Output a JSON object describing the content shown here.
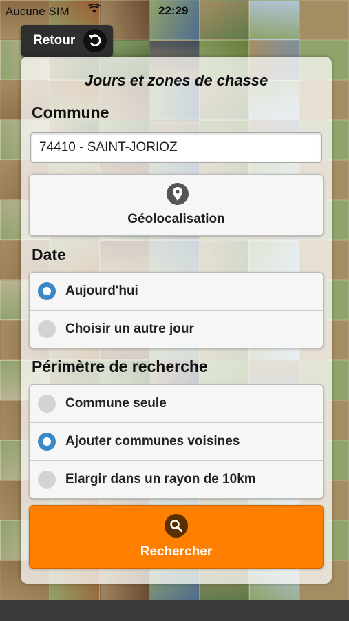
{
  "status": {
    "carrier": "Aucune SIM",
    "time": "22:29",
    "wifi_icon": "wifi-icon"
  },
  "nav": {
    "back_label": "Retour",
    "back_icon": "undo-arrow-icon"
  },
  "form": {
    "title": "Jours et zones de chasse",
    "commune": {
      "label": "Commune",
      "value": "74410 - SAINT-JORIOZ"
    },
    "geolocation": {
      "label": "Géolocalisation",
      "icon": "map-pin-icon"
    },
    "date": {
      "label": "Date",
      "options": [
        {
          "label": "Aujourd'hui",
          "selected": true
        },
        {
          "label": "Choisir un autre jour",
          "selected": false
        }
      ]
    },
    "perimeter": {
      "label": "Périmètre de recherche",
      "options": [
        {
          "label": "Commune seule",
          "selected": false
        },
        {
          "label": "Ajouter communes voisines",
          "selected": true
        },
        {
          "label": "Elargir dans un rayon de 10km",
          "selected": false
        }
      ]
    },
    "search": {
      "label": "Rechercher",
      "icon": "search-icon",
      "color": "#ff8000"
    }
  },
  "colors": {
    "accent": "#3a88c8",
    "search": "#ff8000",
    "back_button": "#2f2f2f"
  }
}
